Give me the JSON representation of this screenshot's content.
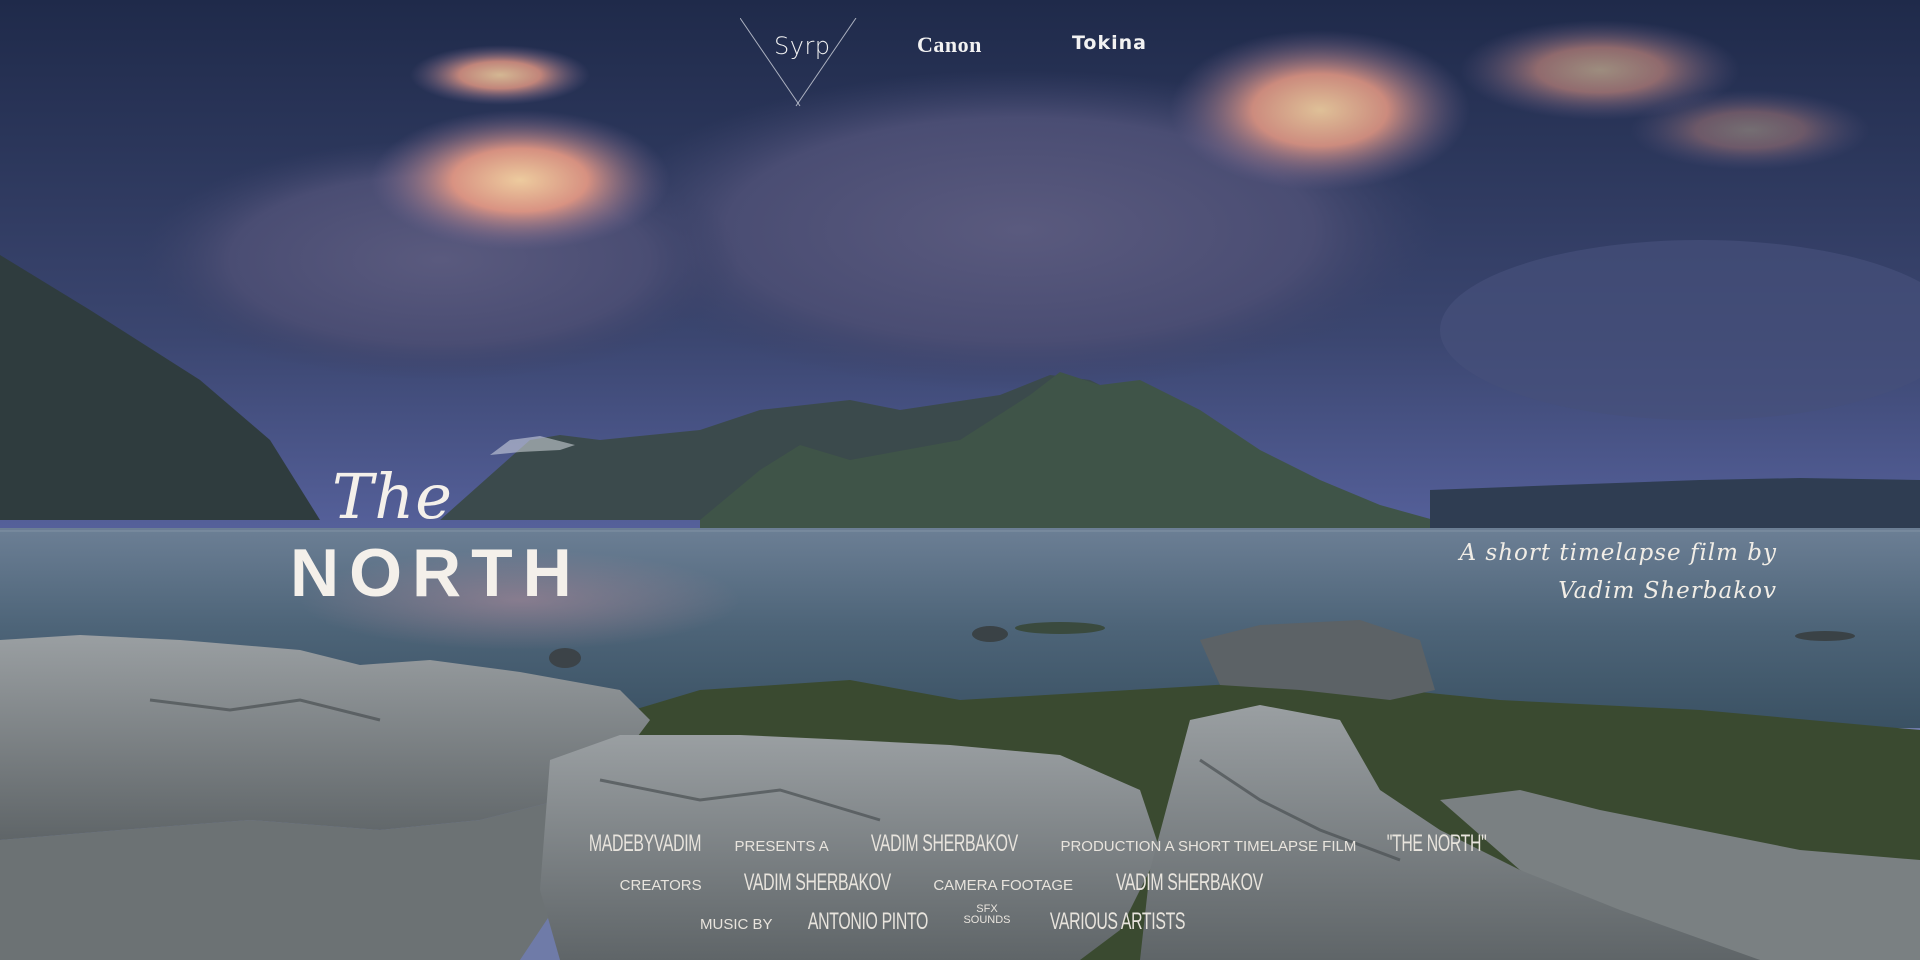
{
  "sponsors": {
    "syrp": "Syrp",
    "canon": "Canon",
    "tokina": "Tokina"
  },
  "title": {
    "line1": "The",
    "line2": "NORTH"
  },
  "byline": {
    "line1": "A short timelapse film by",
    "line2": "Vadim Sherbakov"
  },
  "credits": {
    "row1": {
      "studio": "MADEBYVADIM",
      "presents": "presents a",
      "director": "VADIM SHERBAKOV",
      "production": "production a short timelapse film",
      "film": "\"THE NORTH\""
    },
    "row2": {
      "creators_label": "creators",
      "creators": "VADIM SHERBAKOV",
      "camera_label": "camera footage",
      "camera": "VADIM SHERBAKOV"
    },
    "row3": {
      "music_label": "music by",
      "music": "ANTONIO PINTO",
      "sfx_label_1": "sfx",
      "sfx_label_2": "sounds",
      "sfx": "VARIOUS ARTISTS"
    }
  },
  "colors": {
    "sky_top": "#2b3a63",
    "cloud_glow": "#f2b080",
    "water": "#4f6a80",
    "rocks": "#8a8f90",
    "text": "#f4f0ea"
  }
}
